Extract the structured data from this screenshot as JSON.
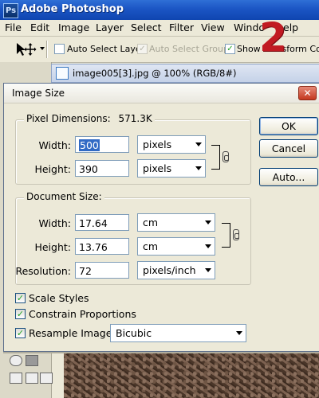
{
  "app": {
    "title": "Adobe Photoshop",
    "logo_letters": "Ps"
  },
  "menubar": {
    "items": [
      "File",
      "Edit",
      "Image",
      "Layer",
      "Select",
      "Filter",
      "View",
      "Windo",
      "elp"
    ]
  },
  "options_bar": {
    "auto_select_layer": {
      "label": "Auto Select Layer",
      "checked": false
    },
    "auto_select_groups": {
      "label": "Auto Select Groups",
      "checked": true,
      "disabled": true
    },
    "show_transform": {
      "label": "Show Transform Contr",
      "checked": true
    }
  },
  "step_number": "2",
  "document": {
    "title": "image005[3].jpg @ 100% (RGB/8#)"
  },
  "dialog": {
    "title": "Image Size",
    "close_glyph": "✕",
    "pixel_dimensions": {
      "label": "Pixel Dimensions:",
      "size": "571.3K",
      "width": {
        "label": "Width:",
        "value": "500",
        "unit": "pixels"
      },
      "height": {
        "label": "Height:",
        "value": "390",
        "unit": "pixels"
      }
    },
    "document_size": {
      "label": "Document Size:",
      "width": {
        "label": "Width:",
        "value": "17.64",
        "unit": "cm"
      },
      "height": {
        "label": "Height:",
        "value": "13.76",
        "unit": "cm"
      },
      "resolution": {
        "label": "Resolution:",
        "value": "72",
        "unit": "pixels/inch"
      }
    },
    "buttons": {
      "ok": "OK",
      "cancel": "Cancel",
      "auto": "Auto..."
    },
    "options": {
      "scale_styles": {
        "label": "Scale Styles",
        "checked": true
      },
      "constrain_proportions": {
        "label": "Constrain Proportions",
        "checked": true
      },
      "resample_image": {
        "label": "Resample Image:",
        "checked": true,
        "method": "Bicubic"
      }
    }
  },
  "colors": {
    "titlebar": "#1b55c4",
    "step_number": "#c11a22",
    "selection": "#316ac5"
  }
}
